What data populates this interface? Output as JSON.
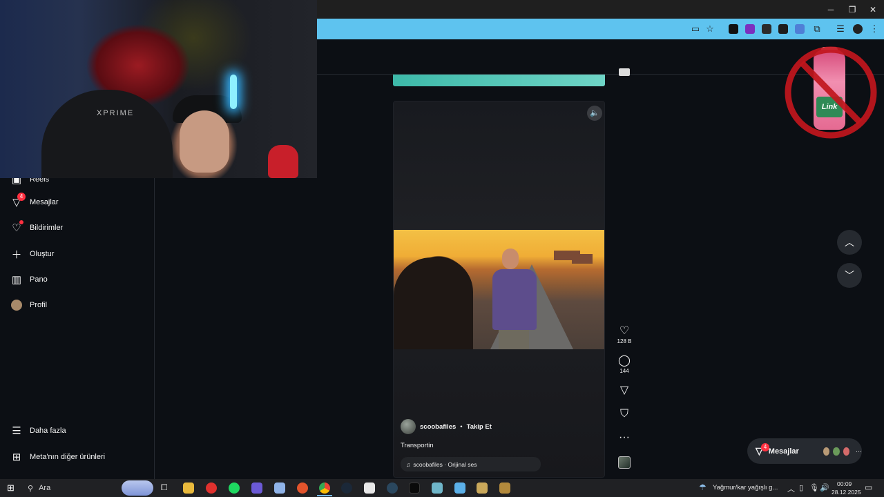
{
  "window": {
    "minimize": "─",
    "restore": "❐",
    "close": "✕"
  },
  "address_icons": [
    "cast-icon",
    "star-icon"
  ],
  "sidebar": {
    "items": [
      {
        "label": "Reels",
        "icon": "reels-icon"
      },
      {
        "label": "Mesajlar",
        "icon": "messages-icon",
        "badge": "4"
      },
      {
        "label": "Bildirimler",
        "icon": "heart-icon"
      },
      {
        "label": "Oluştur",
        "icon": "plus-icon"
      },
      {
        "label": "Pano",
        "icon": "dashboard-icon"
      },
      {
        "label": "Profil",
        "icon": "profile-avatar"
      }
    ],
    "bottom": [
      {
        "label": "Daha fazla",
        "icon": "menu-icon"
      },
      {
        "label": "Meta'nın diğer ürünleri",
        "icon": "grid-icon"
      }
    ]
  },
  "webcam": {
    "brand_text": "XPRIME"
  },
  "reel": {
    "username": "scoobafiles",
    "separator": "•",
    "follow_label": "Takip Et",
    "caption": "Transportin",
    "audio": "scoobafiles · Orijinal ses",
    "sound_icon": "🔈"
  },
  "actions": {
    "likes": "128 B",
    "comments": "144"
  },
  "overlay": {
    "bottle_label": "Link"
  },
  "messages_pill": {
    "label": "Mesajlar",
    "badge": "4",
    "more": "···"
  },
  "taskbar": {
    "search_placeholder": "Ara",
    "weather": "Yağmur/kar yağışlı g...",
    "time": "00:09",
    "date": "28.12.2025"
  },
  "colors": {
    "accent_blue": "#5ec3ef",
    "badge_red": "#ff3040",
    "background": "#0c0f14"
  }
}
